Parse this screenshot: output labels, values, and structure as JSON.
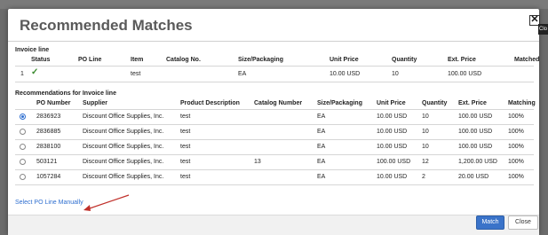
{
  "dialog": {
    "title": "Recommended Matches",
    "close_glyph": "✕",
    "close_tooltip": "Clo"
  },
  "invoice_line": {
    "label": "Invoice line",
    "headers": [
      "Status",
      "PO Line",
      "Item",
      "Catalog No.",
      "Size/Packaging",
      "Unit Price",
      "Quantity",
      "Ext. Price",
      "Matched"
    ],
    "row": {
      "index": "1",
      "status_icon": "check-icon",
      "status_glyph": "✓",
      "po_line": "",
      "item": "test",
      "catalog_no": "",
      "size_packaging": "EA",
      "unit_price": "10.00 USD",
      "quantity": "10",
      "ext_price": "100.00 USD",
      "matched": ""
    }
  },
  "recommendations": {
    "label": "Recommendations for Invoice line",
    "headers": [
      "PO Number",
      "Supplier",
      "Product Description",
      "Catalog Number",
      "Size/Packaging",
      "Unit Price",
      "Quantity",
      "Ext. Price",
      "Matching"
    ],
    "rows": [
      {
        "selected": true,
        "po_number": "2836923",
        "supplier": "Discount Office Supplies, Inc.",
        "description": "test",
        "catalog": "",
        "size": "EA",
        "unit_price": "10.00 USD",
        "quantity": "10",
        "ext_price": "100.00 USD",
        "matching": "100%"
      },
      {
        "selected": false,
        "po_number": "2836885",
        "supplier": "Discount Office Supplies, Inc.",
        "description": "test",
        "catalog": "",
        "size": "EA",
        "unit_price": "10.00 USD",
        "quantity": "10",
        "ext_price": "100.00 USD",
        "matching": "100%"
      },
      {
        "selected": false,
        "po_number": "2838100",
        "supplier": "Discount Office Supplies, Inc.",
        "description": "test",
        "catalog": "",
        "size": "EA",
        "unit_price": "10.00 USD",
        "quantity": "10",
        "ext_price": "100.00 USD",
        "matching": "100%"
      },
      {
        "selected": false,
        "po_number": "503121",
        "supplier": "Discount Office Supplies, Inc.",
        "description": "test",
        "catalog": "13",
        "size": "EA",
        "unit_price": "100.00 USD",
        "quantity": "12",
        "ext_price": "1,200.00 USD",
        "matching": "100%"
      },
      {
        "selected": false,
        "po_number": "1057284",
        "supplier": "Discount Office Supplies, Inc.",
        "description": "test",
        "catalog": "",
        "size": "EA",
        "unit_price": "10.00 USD",
        "quantity": "2",
        "ext_price": "20.00 USD",
        "matching": "100%"
      }
    ]
  },
  "link": {
    "select_manual": "Select PO Line Manually"
  },
  "footer": {
    "match_label": "Match",
    "close_label": "Close"
  },
  "colors": {
    "accent": "#3a73c9",
    "link": "#2f6fd0",
    "check": "#3a8a2e",
    "arrow": "#c0302a"
  }
}
